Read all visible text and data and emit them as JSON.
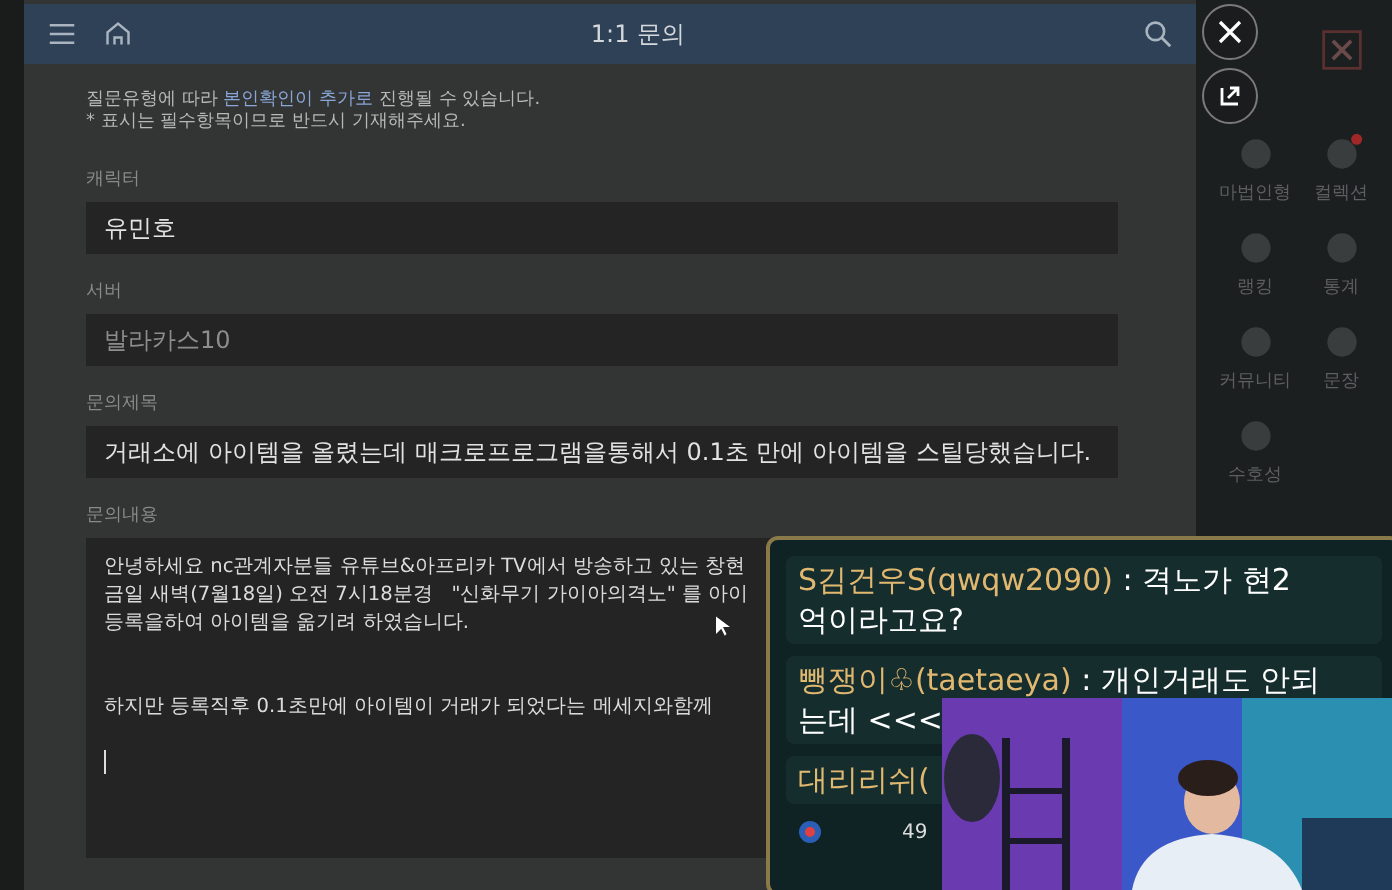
{
  "header": {
    "title": "1:1 문의"
  },
  "notice": [
    {
      "text": "질문유형에 따라 ",
      "highlight": false
    },
    {
      "text": "본인확인이 추가로",
      "highlight": true
    },
    {
      "text": " 진행될 수 있습니다.",
      "highlight": false
    }
  ],
  "required_note": "* 표시는 필수항목이므로 반드시 기재해주세요.",
  "fields": [
    {
      "kind": "input",
      "label": "캐릭터",
      "value": "유민호",
      "disabled": false
    },
    {
      "kind": "input",
      "label": "서버",
      "value": "발라카스10",
      "disabled": true
    },
    {
      "kind": "input",
      "label": "문의제목",
      "value": "거래소에 아이템을 올렸는데 매크로프로그램을통해서 0.1초 만에 아이템을 스틸당했습니다.",
      "disabled": false
    },
    {
      "kind": "textarea",
      "label": "문의내용",
      "paragraphs": [
        [
          "안녕하세요 nc관계자분들 유튜브&아프리카 TV에서 방송하고 있는 창현",
          "금일 새벽(7월18일) 오전 7시18분경   \"신화무기 가이아의격노\" 를 아이",
          "등록을하여 아이템을 옮기려 하였습니다."
        ],
        [
          "하지만 등록직후 0.1초만에 아이템이 거래가 되었다는 메세지와함께"
        ]
      ],
      "disabled": false
    }
  ],
  "side_menu": [
    {
      "label": "마법인형",
      "alert": false
    },
    {
      "label": "컬렉션",
      "alert": true
    },
    {
      "label": "랭킹",
      "alert": false
    },
    {
      "label": "통계",
      "alert": false
    },
    {
      "label": "커뮤니티",
      "alert": false
    },
    {
      "label": "문장",
      "alert": false
    },
    {
      "label": "수호성",
      "alert": false
    }
  ],
  "chat": {
    "messages": [
      {
        "user": "S김건우S(qwqw2090)",
        "lines": [
          " : 격노가 현2",
          "억이라고요?"
        ]
      },
      {
        "user": "뺑쟁이♧(taetaeya)",
        "lines": [
          " : 개인거래도 안되",
          "는데 <<<"
        ]
      },
      {
        "user": "대리리쉬("
      }
    ],
    "viewers": "49"
  }
}
